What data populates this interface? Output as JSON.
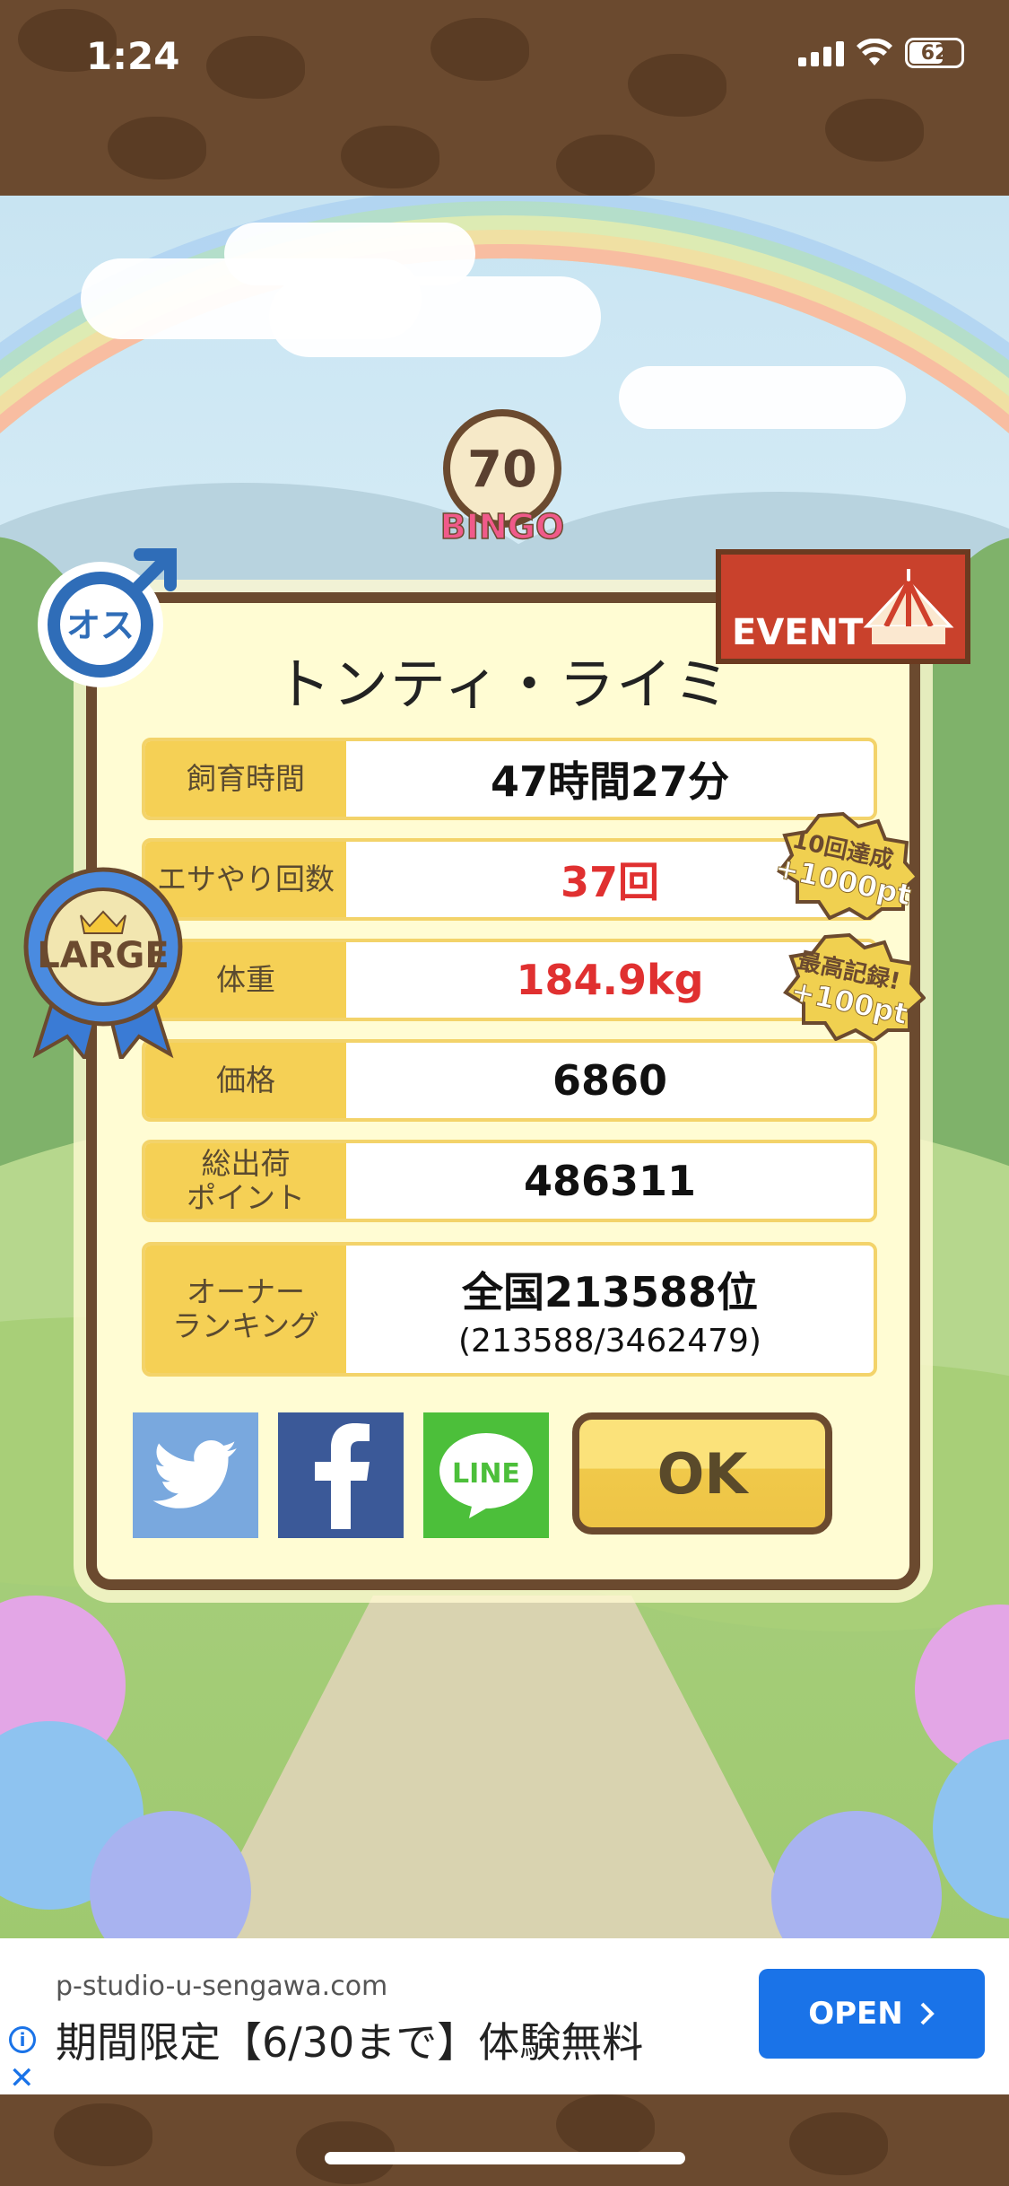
{
  "status_bar": {
    "time": "1:24",
    "battery": "62"
  },
  "header": {
    "bingo_number": "70",
    "bingo_label": "BINGO",
    "gender_label": "オス",
    "event_label": "EVENT"
  },
  "pet": {
    "name": "トンティ・ライミ",
    "size_label": "LARGE"
  },
  "stats": [
    {
      "label": "飼育時間",
      "value": "47時間27分"
    },
    {
      "label": "エサやり回数",
      "value": "37回"
    },
    {
      "label": "体重",
      "value": "184.9kg"
    },
    {
      "label": "価格",
      "value": "6860"
    },
    {
      "label": "総出荷\nポイント",
      "value": "486311"
    },
    {
      "label": "オーナー\nランキング",
      "value": "全国213588位",
      "sub": "(213588/3462479)"
    }
  ],
  "badges": [
    {
      "line1": "10回達成",
      "line2": "+1000pt"
    },
    {
      "line1": "最高記録!",
      "line2": "+100pt"
    }
  ],
  "share": {
    "line_label": "LINE"
  },
  "ok_label": "OK",
  "ad": {
    "url": "p-studio-u-sengawa.com",
    "text": "期間限定【6/30まで】体験無料",
    "open_label": "OPEN"
  },
  "colors": {
    "panel_border": "#6b4a2f",
    "label_bg": "#f5d055",
    "accent_red": "#e03030",
    "twitter": "#79a8de",
    "facebook": "#3b5998",
    "line": "#4cbf3a",
    "ad_button": "#1a73e8"
  }
}
